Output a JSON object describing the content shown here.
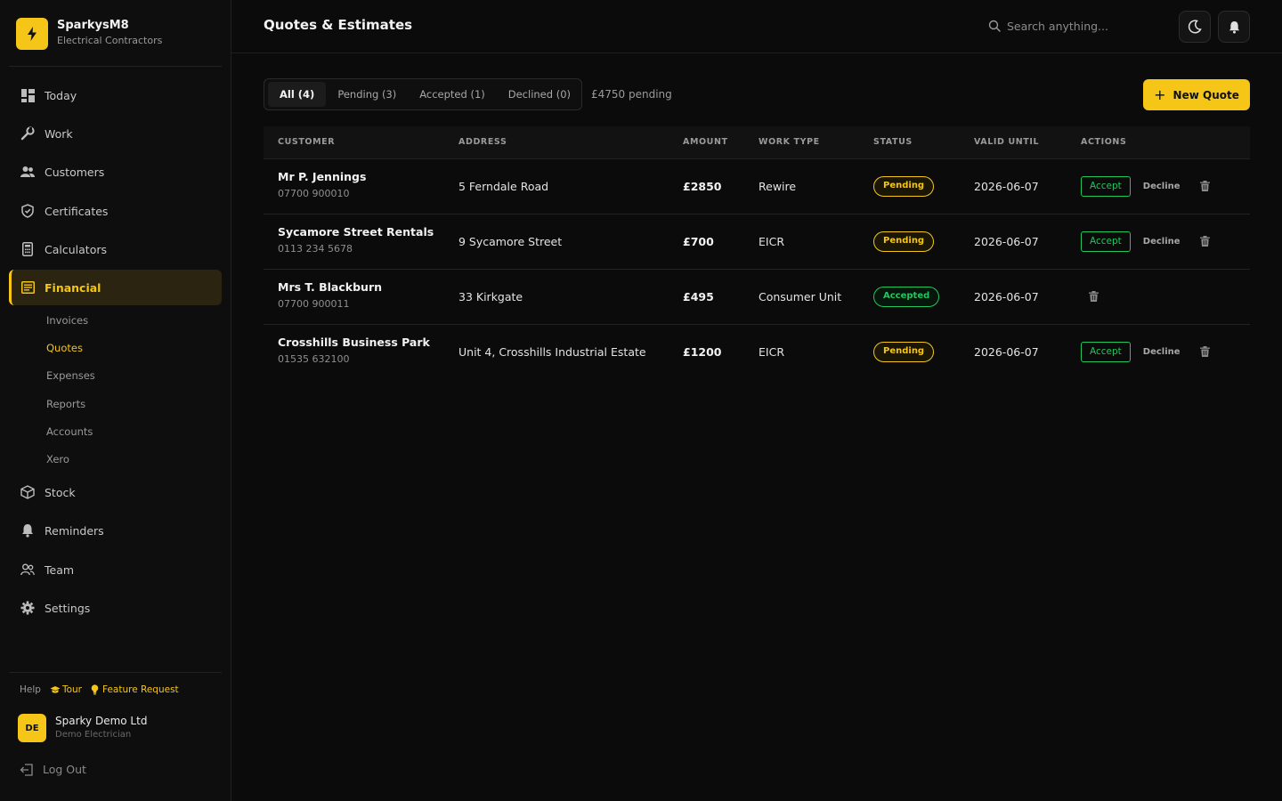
{
  "brand": {
    "name": "SparkysM8",
    "subtitle": "Electrical Contractors"
  },
  "nav": {
    "items": [
      {
        "label": "Today",
        "icon": "dashboard-icon"
      },
      {
        "label": "Work",
        "icon": "wrench-icon"
      },
      {
        "label": "Customers",
        "icon": "users-icon"
      },
      {
        "label": "Certificates",
        "icon": "shield-icon"
      },
      {
        "label": "Calculators",
        "icon": "calculator-icon"
      },
      {
        "label": "Financial",
        "icon": "ledger-icon"
      },
      {
        "label": "Stock",
        "icon": "box-icon"
      },
      {
        "label": "Reminders",
        "icon": "bell-icon"
      },
      {
        "label": "Team",
        "icon": "team-icon"
      },
      {
        "label": "Settings",
        "icon": "gear-icon"
      }
    ],
    "active": "Financial",
    "financial_sub": [
      "Invoices",
      "Quotes",
      "Expenses",
      "Reports",
      "Accounts",
      "Xero"
    ],
    "active_sub": "Quotes"
  },
  "help": {
    "label": "Help",
    "tour": "Tour",
    "feature_request": "Feature Request"
  },
  "user": {
    "initials": "DE",
    "name": "Sparky Demo Ltd",
    "role": "Demo Electrician"
  },
  "logout": "Log Out",
  "header": {
    "title": "Quotes & Estimates",
    "search_placeholder": "Search anything..."
  },
  "tabs": [
    {
      "label": "All (4)",
      "active": true
    },
    {
      "label": "Pending (3)",
      "active": false
    },
    {
      "label": "Accepted (1)",
      "active": false
    },
    {
      "label": "Declined (0)",
      "active": false
    }
  ],
  "pending_total": "£4750 pending",
  "new_quote_label": "New Quote",
  "table": {
    "headers": [
      "CUSTOMER",
      "ADDRESS",
      "AMOUNT",
      "WORK TYPE",
      "STATUS",
      "VALID UNTIL",
      "ACTIONS"
    ],
    "rows": [
      {
        "name": "Mr P. Jennings",
        "phone": "07700 900010",
        "address": "5 Ferndale Road",
        "amount": "£2850",
        "work_type": "Rewire",
        "status": "Pending",
        "valid_until": "2026-06-07",
        "accept": "Accept",
        "decline": "Decline"
      },
      {
        "name": "Sycamore Street Rentals",
        "phone": "0113 234 5678",
        "address": "9 Sycamore Street",
        "amount": "£700",
        "work_type": "EICR",
        "status": "Pending",
        "valid_until": "2026-06-07",
        "accept": "Accept",
        "decline": "Decline"
      },
      {
        "name": "Mrs T. Blackburn",
        "phone": "07700 900011",
        "address": "33 Kirkgate",
        "amount": "£495",
        "work_type": "Consumer Unit",
        "status": "Accepted",
        "valid_until": "2026-06-07"
      },
      {
        "name": "Crosshills Business Park",
        "phone": "01535 632100",
        "address": "Unit 4, Crosshills Industrial Estate",
        "amount": "£1200",
        "work_type": "EICR",
        "status": "Pending",
        "valid_until": "2026-06-07",
        "accept": "Accept",
        "decline": "Decline"
      }
    ]
  },
  "colors": {
    "accent": "#f5c518",
    "success": "#22c55e",
    "background": "#0b0b0b"
  }
}
